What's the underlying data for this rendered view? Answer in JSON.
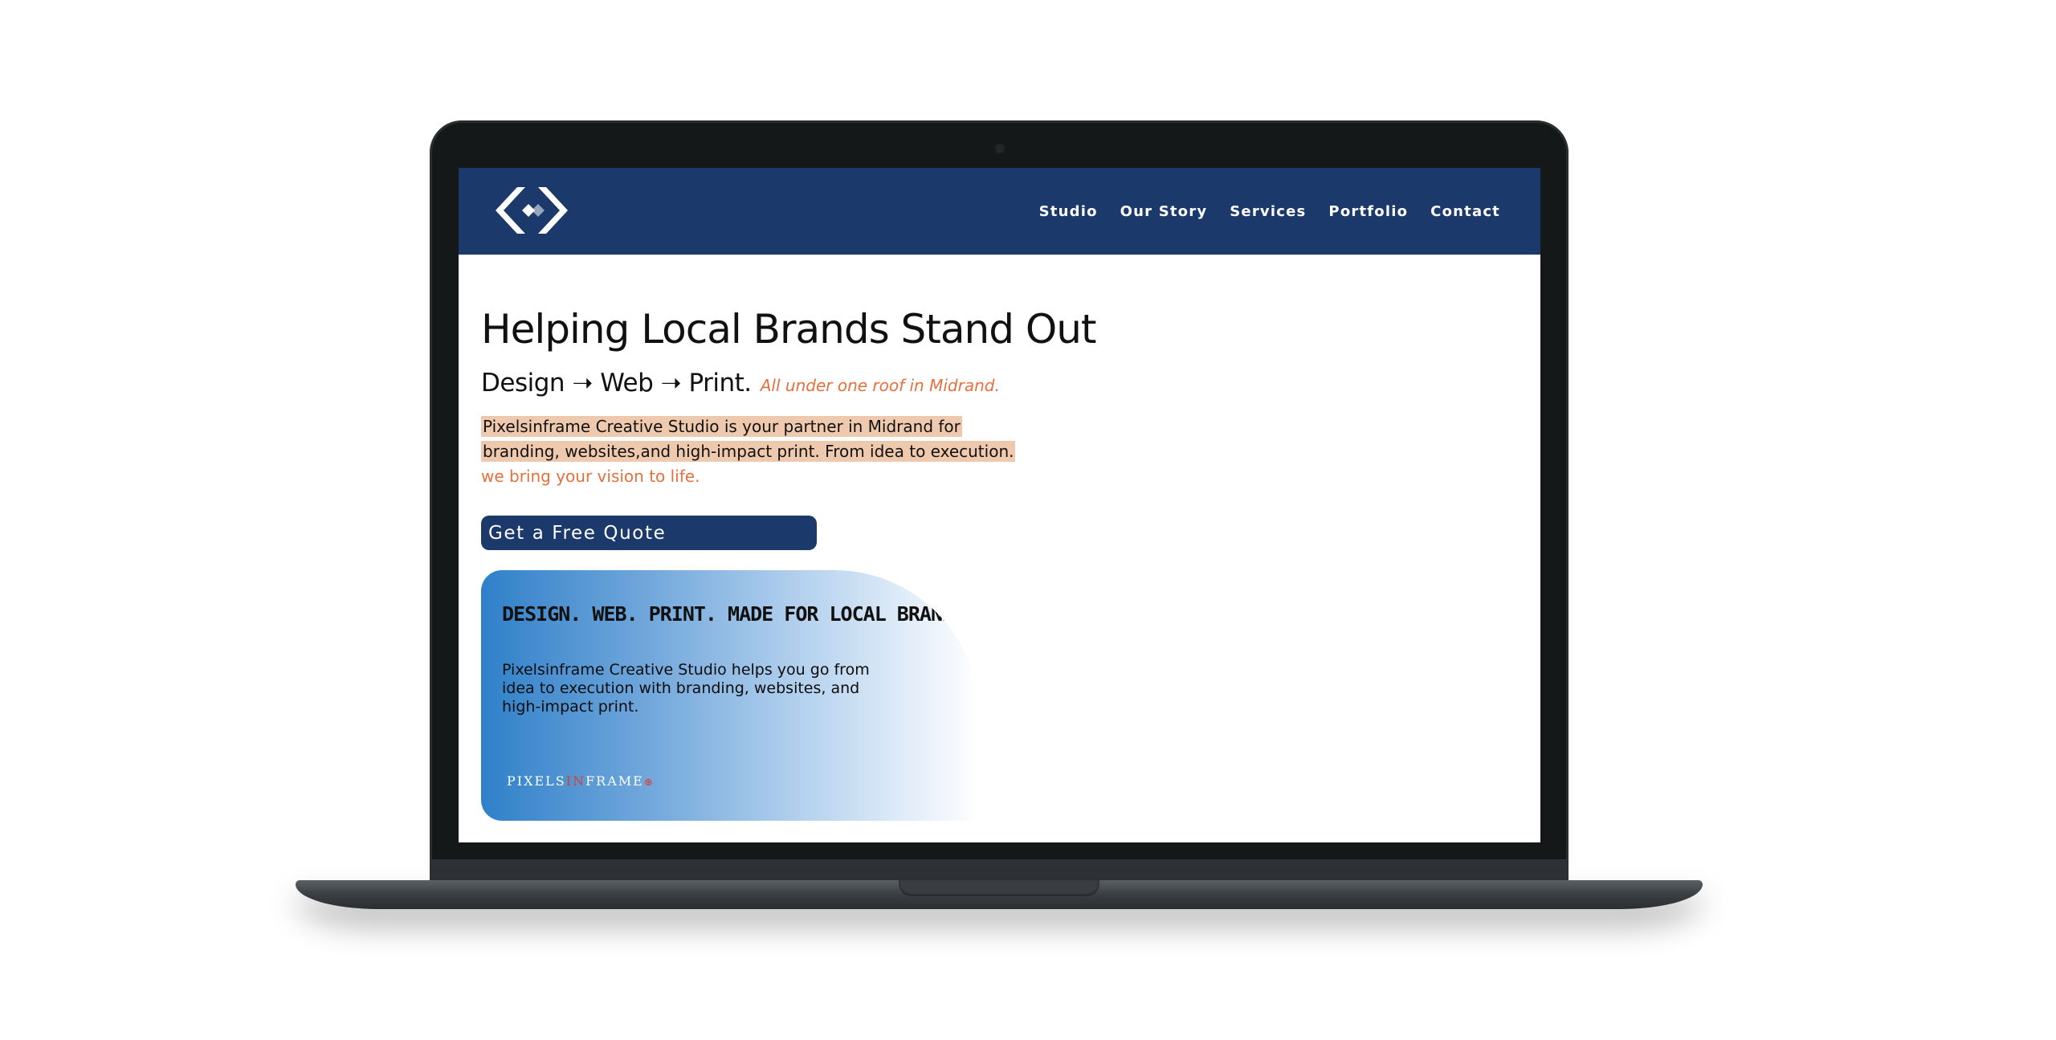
{
  "colors": {
    "header_bg": "#1b3a6b",
    "accent_orange": "#e76f3c",
    "highlight": "#eec9ad",
    "button_bg": "#1b3a6b",
    "banner_blue": "#2f80c9",
    "brand_red": "#e23a2a"
  },
  "header": {
    "logo_icon": "diamond-brackets-logo",
    "nav": [
      {
        "label": "Studio"
      },
      {
        "label": "Our Story"
      },
      {
        "label": "Services"
      },
      {
        "label": "Portfolio"
      },
      {
        "label": "Contact"
      }
    ]
  },
  "hero": {
    "title": "Helping Local Brands Stand Out",
    "tagline_main": "Design ➝ Web ➝ Print.",
    "tagline_note": "All under one roof in Midrand.",
    "intro_highlighted": "Pixelsinframe Creative Studio is your partner in Midrand for branding, websites,and high-impact print. From idea to execution.",
    "intro_vision": "we bring your vision to life.",
    "cta_label": "Get a Free Quote"
  },
  "banner": {
    "headline": "DESIGN. WEB. PRINT. MADE FOR LOCAL BRANDS.",
    "body": "Pixelsinframe Creative Studio helps you go from idea to execution with branding, websites, and high-impact print.",
    "brand_part1": "PIXELS",
    "brand_part2": "IN",
    "brand_part3": "FRAME",
    "brand_icon": "⊛"
  }
}
